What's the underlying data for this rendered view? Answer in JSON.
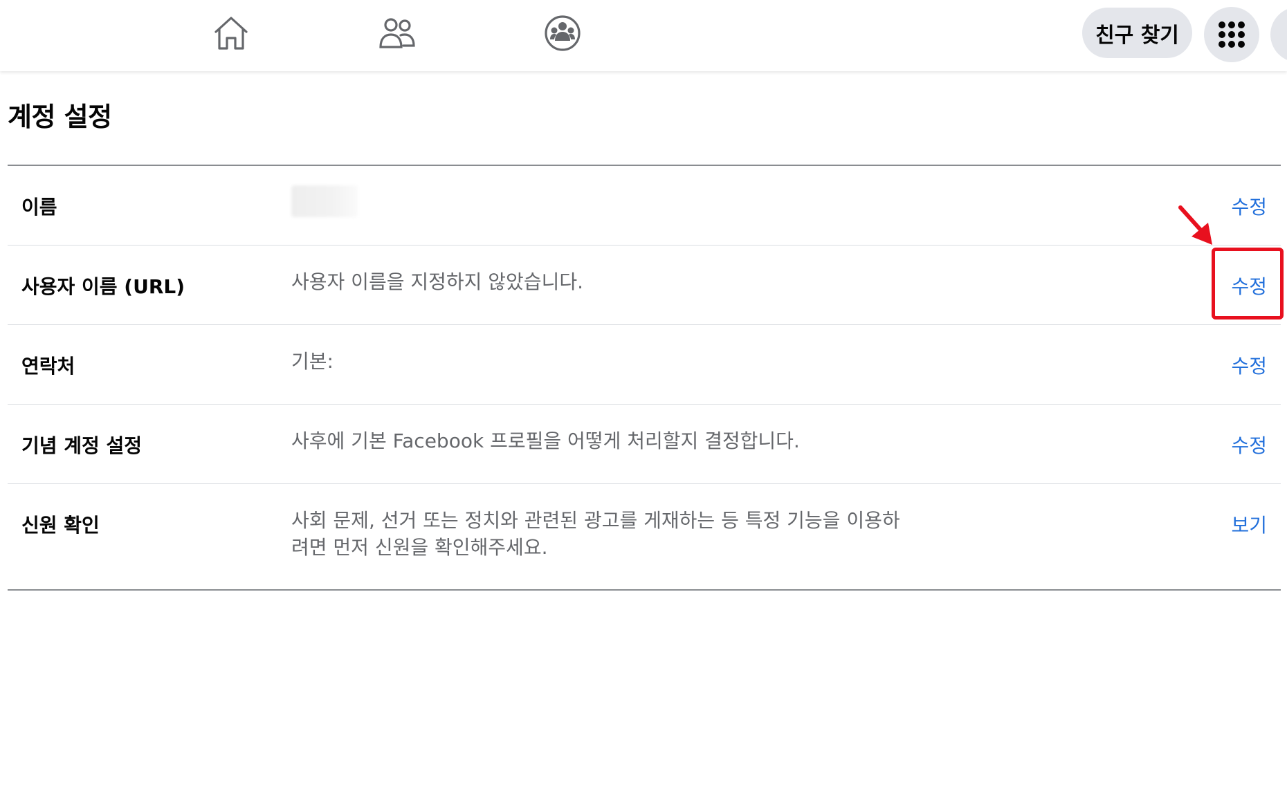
{
  "nav": {
    "icons": [
      "home-icon",
      "friends-icon",
      "groups-icon"
    ],
    "find_friends_label": "친구 찾기",
    "menu_icon": "grid-menu-icon"
  },
  "page": {
    "title": "계정 설정"
  },
  "settings": {
    "rows": [
      {
        "label": "이름",
        "value": "",
        "action": "수정"
      },
      {
        "label": "사용자 이름 (URL)",
        "value": "사용자 이름을 지정하지 않았습니다.",
        "action": "수정"
      },
      {
        "label": "연락처",
        "value": "기본:",
        "action": "수정"
      },
      {
        "label": "기념 계정 설정",
        "value": "사후에 기본 Facebook 프로필을 어떻게 처리할지 결정합니다.",
        "action": "수정"
      },
      {
        "label": "신원 확인",
        "value": "사회 문제, 선거 또는 정치와 관련된 광고를 게재하는 등 특정 기능을 이용하려면 먼저 신원을 확인해주세요.",
        "action": "보기"
      }
    ]
  },
  "annotation": {
    "highlight_color": "#e8101e",
    "target": "수정"
  },
  "colors": {
    "link": "#216fdb",
    "muted": "#65676b",
    "pill_bg": "#e4e6eb"
  }
}
